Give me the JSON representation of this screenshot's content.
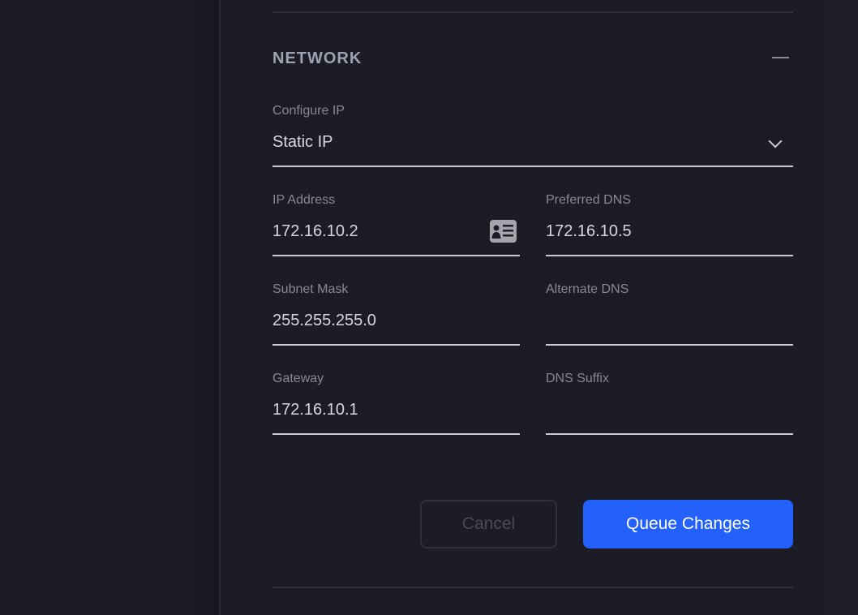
{
  "section": {
    "title": "NETWORK",
    "collapse_icon": "minus-icon"
  },
  "configure_ip": {
    "label": "Configure IP",
    "value": "Static IP"
  },
  "fields": {
    "ip_address": {
      "label": "IP Address",
      "value": "172.16.10.2",
      "icon": "contact-card-icon"
    },
    "preferred_dns": {
      "label": "Preferred DNS",
      "value": "172.16.10.5"
    },
    "subnet_mask": {
      "label": "Subnet Mask",
      "value": "255.255.255.0"
    },
    "alternate_dns": {
      "label": "Alternate DNS",
      "value": ""
    },
    "gateway": {
      "label": "Gateway",
      "value": "172.16.10.1"
    },
    "dns_suffix": {
      "label": "DNS Suffix",
      "value": ""
    }
  },
  "buttons": {
    "cancel": "Cancel",
    "queue": "Queue Changes"
  },
  "colors": {
    "accent": "#2461fb",
    "background": "#1c1c27"
  }
}
